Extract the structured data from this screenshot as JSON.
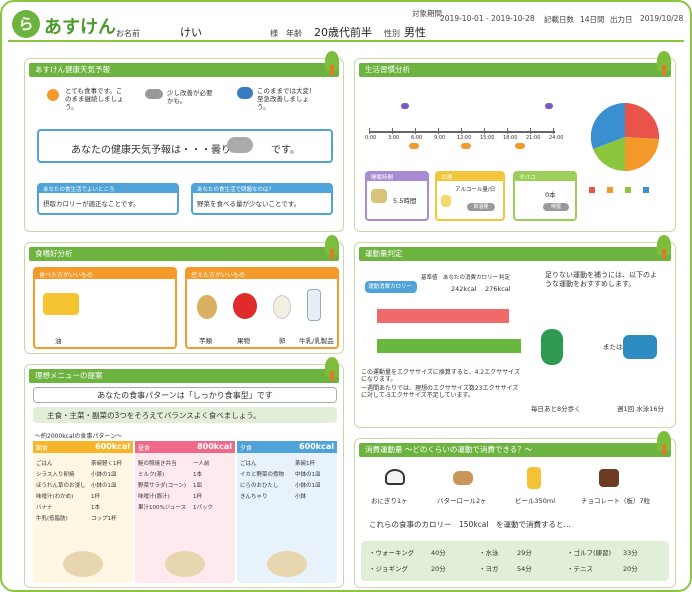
{
  "header": {
    "app": "あすけん",
    "name_label": "お名前",
    "name": "けい",
    "sama": "様",
    "age_label": "年齢",
    "age": "20歳代前半",
    "sex_label": "性別",
    "sex": "男性",
    "period_label": "対象期間",
    "period": "2019-10-01 - 2019-10-28",
    "days_label": "記載日数",
    "days": "14日間",
    "out_label": "出力日",
    "out_date": "2019/10/28"
  },
  "health": {
    "title": "あすけん健康天気予報",
    "w1": "とても食事です。このまま継続しましょう。",
    "w2": "少し改善が必要かも。",
    "w3": "このままでは大変！至急改善しましょう。",
    "main": "あなたの健康天気予報は・・・曇り",
    "main_end": "です。",
    "q1": "あなたの食生活でよいところ",
    "a1": "摂取カロリーが適正なことです。",
    "q2": "あなたの食生活で問題なのは？",
    "a2": "野菜を食べる量が少ないことです。"
  },
  "habits": {
    "title": "生活習慣分析",
    "ticks": [
      "0:00",
      "3:00",
      "6:00",
      "9:00",
      "12:00",
      "15:00",
      "18:00",
      "21:00",
      "24:00"
    ],
    "c1_label": "睡眠時間",
    "c1_val": "5.5時間",
    "c2_label": "お酒",
    "c2_sub": "アルコール量/日",
    "c2_val": "飲酒量",
    "c3_label": "タバコ",
    "c3_val": "0本",
    "c3_sub": "喫煙"
  },
  "pref": {
    "title": "食嗜好分析",
    "likes": "食べた方がいいもの",
    "like1": "油",
    "dislikes": "控えた方がいいもの",
    "d1": "芋類",
    "d2": "果物",
    "d3": "卵",
    "d4": "牛乳/乳製品"
  },
  "exercise": {
    "title": "運動量判定",
    "col1": "基準値",
    "col2": "あなたの消費カロリー",
    "col3": "判定",
    "row1": "運動消費カロリー",
    "v1": "242kcal",
    "v2": "276kcal",
    "note": "足りない運動を補うには、以下のような運動をおすすめします。",
    "desc1": "この運動量をエクササイズに換算すると、4.2エクササイズになります。",
    "desc2": "一週間あたりでは、理想のエクササイズ数23エクササイズに対して-5エクササイズ不足しています。",
    "or": "または",
    "act1": "毎日あと8分歩く",
    "act2": "週1回 水泳16分"
  },
  "menu": {
    "title": "理想メニューの提案",
    "pattern": "あなたの食事パターンは「しっかり食事型」です",
    "main": "主食・主菜・副菜の3つをそろえてバランスよく食べましょう。",
    "sub": "〜約2000kcalの食事パターン〜",
    "meals": [
      {
        "name": "朝食",
        "kcal": "600kcal",
        "items": [
          [
            "ごはん",
            "茶碗軽く1杯"
          ],
          [
            "シラス入り卵焼",
            "小鉢の1皿"
          ],
          [
            "ほうれん草のお浸し",
            "小鉢の1皿"
          ],
          [
            "味噌汁(わかめ)",
            "1杯"
          ],
          [
            "バナナ",
            "1本"
          ],
          [
            "牛乳(低脂肪)",
            "コップ1杯"
          ]
        ]
      },
      {
        "name": "昼食",
        "kcal": "800kcal",
        "items": [
          [
            "鮭の照焼き弁当",
            "一人前"
          ],
          [
            "ミルク(茶)",
            "1本"
          ],
          [
            "野菜サラダ(コーン)",
            "1皿"
          ],
          [
            "味噌汁(豚汁)",
            "1杯"
          ],
          [
            "果汁100%ジュース",
            "1パック"
          ]
        ]
      },
      {
        "name": "夕食",
        "kcal": "600kcal",
        "items": [
          [
            "ごはん",
            "茶碗1杯"
          ],
          [
            "イカと野菜の煮物",
            "中鉢の1皿"
          ],
          [
            "にらのおひたし",
            "小鉢の1皿"
          ],
          [
            "きんちゃり",
            "小鉢"
          ]
        ]
      }
    ]
  },
  "burn": {
    "title": "消費運動量 〜どのくらいの運動で消費できる？〜",
    "f1": "おにぎり1ヶ",
    "f2": "バターロール2ヶ",
    "f3": "ビール350ml",
    "f4": "チョコレート（板）7粒",
    "lead": "これらの食事のカロリー　150kcal　を運動で消費すると…",
    "rows": [
      [
        "ウォーキング",
        "40分",
        "水泳",
        "29分",
        "ゴルフ(練習)",
        "33分"
      ],
      [
        "ジョギング",
        "20分",
        "ヨガ",
        "54分",
        "テニス",
        "20分"
      ]
    ]
  }
}
